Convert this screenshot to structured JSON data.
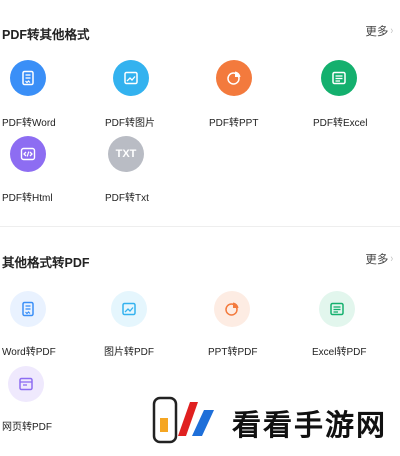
{
  "section1": {
    "title": "PDF转其他格式",
    "more": "更多",
    "tools": [
      {
        "label": "PDF转Word",
        "icon": "doc-icon",
        "color": "#3a8ff7"
      },
      {
        "label": "PDF转图片",
        "icon": "image-icon",
        "color": "#33b2ef"
      },
      {
        "label": "PDF转PPT",
        "icon": "pie-icon",
        "color": "#f37a3d"
      },
      {
        "label": "PDF转Excel",
        "icon": "table-icon",
        "color": "#14b06e"
      },
      {
        "label": "PDF转Html",
        "icon": "code-icon",
        "color": "#8d6df2"
      },
      {
        "label": "PDF转Txt",
        "icon": "txt-icon",
        "color": "#b9bcc4",
        "glyph_text": "TXT"
      }
    ]
  },
  "section2": {
    "title": "其他格式转PDF",
    "more": "更多",
    "tools": [
      {
        "label": "Word转PDF",
        "icon": "doc-icon",
        "color": "#e9f2ff",
        "stroke": "#3a8ff7"
      },
      {
        "label": "图片转PDF",
        "icon": "image-icon",
        "color": "#e5f6fd",
        "stroke": "#33b2ef"
      },
      {
        "label": "PPT转PDF",
        "icon": "pie-icon",
        "color": "#fdece3",
        "stroke": "#f37a3d"
      },
      {
        "label": "Excel转PDF",
        "icon": "table-icon",
        "color": "#e2f6ed",
        "stroke": "#14b06e"
      },
      {
        "label": "网页转PDF",
        "icon": "web-icon",
        "color": "#efe9fd",
        "stroke": "#8d6df2"
      }
    ]
  },
  "watermark": {
    "text": "看看手游网"
  }
}
